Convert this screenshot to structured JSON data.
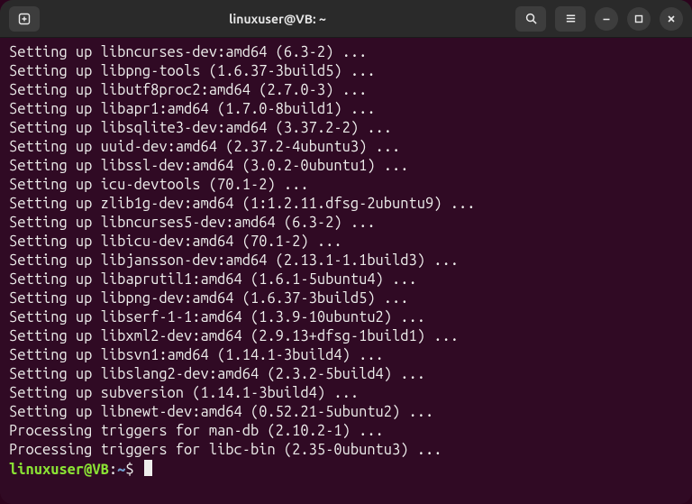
{
  "window": {
    "title": "linuxuser@VB: ~"
  },
  "terminal": {
    "lines": [
      "Setting up libncurses-dev:amd64 (6.3-2) ...",
      "Setting up libpng-tools (1.6.37-3build5) ...",
      "Setting up libutf8proc2:amd64 (2.7.0-3) ...",
      "Setting up libapr1:amd64 (1.7.0-8build1) ...",
      "Setting up libsqlite3-dev:amd64 (3.37.2-2) ...",
      "Setting up uuid-dev:amd64 (2.37.2-4ubuntu3) ...",
      "Setting up libssl-dev:amd64 (3.0.2-0ubuntu1) ...",
      "Setting up icu-devtools (70.1-2) ...",
      "Setting up zlib1g-dev:amd64 (1:1.2.11.dfsg-2ubuntu9) ...",
      "Setting up libncurses5-dev:amd64 (6.3-2) ...",
      "Setting up libicu-dev:amd64 (70.1-2) ...",
      "Setting up libjansson-dev:amd64 (2.13.1-1.1build3) ...",
      "Setting up libaprutil1:amd64 (1.6.1-5ubuntu4) ...",
      "Setting up libpng-dev:amd64 (1.6.37-3build5) ...",
      "Setting up libserf-1-1:amd64 (1.3.9-10ubuntu2) ...",
      "Setting up libxml2-dev:amd64 (2.9.13+dfsg-1build1) ...",
      "Setting up libsvn1:amd64 (1.14.1-3build4) ...",
      "Setting up libslang2-dev:amd64 (2.3.2-5build4) ...",
      "Setting up subversion (1.14.1-3build4) ...",
      "Setting up libnewt-dev:amd64 (0.52.21-5ubuntu2) ...",
      "Processing triggers for man-db (2.10.2-1) ...",
      "Processing triggers for libc-bin (2.35-0ubuntu3) ..."
    ],
    "prompt": {
      "user_host": "linuxuser@VB",
      "colon": ":",
      "path": "~",
      "dollar": "$"
    }
  }
}
